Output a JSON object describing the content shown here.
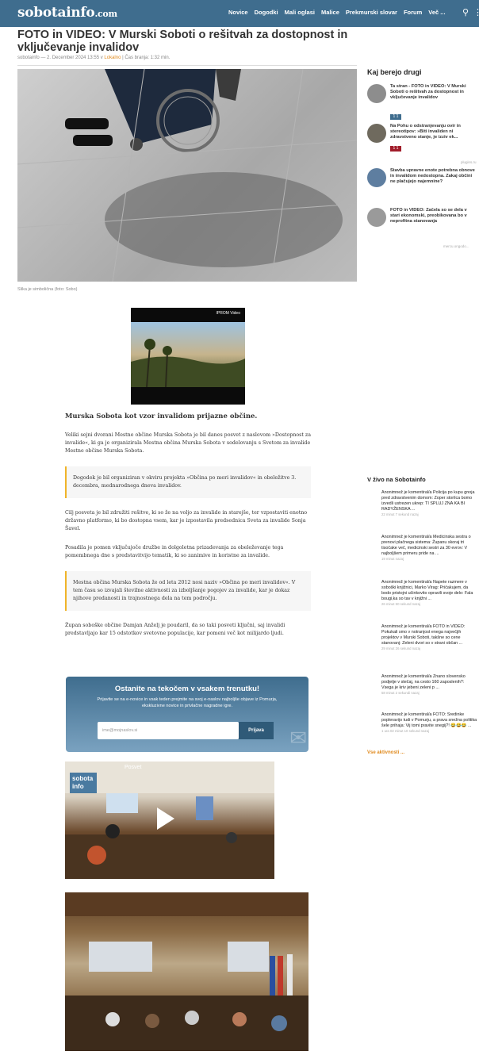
{
  "nav": {
    "logo": "sobotainfo",
    "logo_suffix": ".com",
    "items": [
      "Novice",
      "Dogodki",
      "Mali oglasi",
      "Malice",
      "Prekmurski slovar",
      "Forum",
      "Več ..."
    ],
    "search_icon": "search-icon",
    "more_icon": "more-icon"
  },
  "article": {
    "title": "FOTO in VIDEO: V Murski Soboti o rešitvah za dostopnost in vključevanje invalidov",
    "meta_prefix": "sobotainfo — 2. December 2024 13:55 v ",
    "category": "Lokalno",
    "meta_suffix": " | Čas branja: 1:32 min.",
    "caption": "Slika je simbolična (foto: Sobo)",
    "video_label": "IPROM Video",
    "subtitle": "Murska Sobota kot vzor invalidom prijazne občine.",
    "p1": "Veliki sejni dvorani Mestne občine Murska Sobota je bil danes posvet z naslovom »Dostopnost za invalide«, ki ga je organizirala Mestna občina Murska Sobota v sodelovanju s Svetom za invalide Mestne občine Murska Sobota.",
    "q1": "Dogodek je bil organiziran v okviru projekta »Občina po meri invalidov« in obeležitve 3. decembra, mednarodnega dneva invalidov.",
    "p2": "Cilj posveta je bil združiti rešitve, ki so že na voljo za invalide in starejše, ter vzpostaviti enotno državno platformo, ki bo dostopna vsem, kar je izpostavila predsednica Sveta za invalide Sonja Šavel.",
    "p3": "Posadila je pomen vključujoče družbe in dolgoletna prizadevanja za obeleževanje tega pomembnega dne s predstavitvijo tematik, ki so zanimive in koristne za invalide.",
    "q2": "Mestna občina Murska Sobota že od leta 2012 nosi naziv »Občina po meri invalidov«. V tem času so izvajali številne aktivnosti za izboljšanje pogojev za invalide, kar je dokaz njihove predanosti in trajnostnega dela na tem področju.",
    "p4": "Župan soboške občine Damjan Anželj je poudaril, da so taki posveti ključni, saj invalidi predstavljajo kar 15 odstotkov svetovne populacije, kar pomeni več kot milijardo ljudi."
  },
  "newsletter": {
    "title": "Ostanite na tekočem v vsakem trenutku!",
    "text": "Prijavite se na e-novice in vsak teden prejmite na svoj e-naslov najboljše objave iz Pomurja, ekskluzivne novice in privlačne nagradne igre.",
    "placeholder": "ime@mojnaslov.si",
    "button": "Prijava"
  },
  "video": {
    "title": "Posvet",
    "logo_line1": "sobota",
    "logo_line2": "info"
  },
  "sidebar": {
    "title": "Kaj berejo drugi",
    "items": [
      {
        "text": "Ta stran - FOTO in VIDEO: V Murski Soboti o rešitvah za dostopnost in vključevanje invalidov",
        "badge": "1 1"
      },
      {
        "text": "Na Pohu o odstranjevanju ovir in stereotipov: »Biti invaliden ni zdravstveno stanje, je izziv ek...",
        "badge": "1 1"
      },
      {
        "text": "Stavba upravne enote potrebna obnove in invalidom nedostopna. Zakaj občini ne plačujejo najemnine?"
      },
      {
        "text": "FOTO in VIDEO: Začela so se dela v stari ekonomski, preobikovana bo v neprofitna stanovanja"
      }
    ],
    "ad_label": "plugins.ru",
    "powered_label": "mercu.ongodo..."
  },
  "live": {
    "title": "V živo na Sobotainfo",
    "items": [
      {
        "text": "Anonimnež je komentiral/a Policija po kupu gnoja pred zdravstvenim domom: Zoper storilca bomo izvedli ustrezen ukrep: TI SPLUJ ZNA KA BI RADYŽENSKA ...",
        "time": "22 minut 7 sekund nazaj"
      },
      {
        "text": "Anonimnež je komentiral/a Medicinska sestra o prenovi plačnega sistema: Županu skoraj tri tisočake več, medicinski sestri za 30 evrov: V najboljšem primeru pride na ...",
        "time": "19 minut nazaj"
      },
      {
        "text": "Anonimnež je komentiral/a Napete razmere v soboški knjižnici, Marko Virag: Pričakujem, da bodo pristojni učinkovito opravili svoje delo: Fala bougi,ka so tav v knjižni ...",
        "time": "26 minut 50 sekund nazaj"
      },
      {
        "text": "Anonimnež je komentiral/a FOTO in VIDEO: Pokukali smo v notranjost enega največjih projektov v Murski Soboti, takšne so cene stanovanj: Zeleni dvori so v strani občan ...",
        "time": "29 minut 26 sekund nazaj"
      },
      {
        "text": "Anonimnež je komentiral/a Znano slovensko podjetje v stečaj, na cesto 160 zaposlenih?: Vsega je kriv jebeni zeleni p ...",
        "time": "58 minut 2 sekundi nazaj"
      },
      {
        "text": "Anonimnež je komentiral/a FOTO: Sredinke popleravijo tudi v Pomurju, a prava snežna politika šele prihaja: Vij tomi pravite snegij?! 😂😂😂 ...",
        "time": "1 ura 02 minut 10 sekund nazaj"
      }
    ],
    "more": "Vse aktivnosti ..."
  },
  "colors": {
    "brand": "#3f6d8e",
    "accent": "#e08a1e",
    "quote_border": "#f0b429"
  }
}
